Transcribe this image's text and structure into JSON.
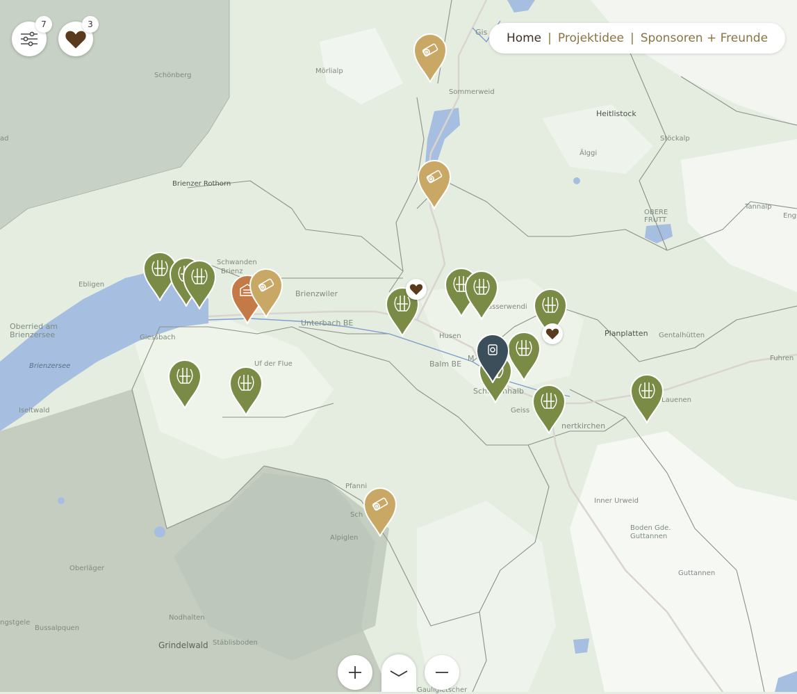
{
  "header": {
    "filter_count": "7",
    "favorites_count": "3"
  },
  "nav": {
    "items": [
      {
        "label": "Home"
      },
      {
        "label": "Projektidee"
      },
      {
        "label": "Sponsoren + Freunde"
      }
    ],
    "separator": "|"
  },
  "places": {
    "giswil": "Gis",
    "moerlialp": "Mörlialp",
    "sommerweid": "Sommerweid",
    "heitlistock": "Heitlistock",
    "stoeckalp": "Stöckalp",
    "aelggi": "Älggi",
    "schoenberg": "Schönberg",
    "brienzer_rothorn": "Brienzer Rothorn",
    "obere_frutt": "OBERE\nFRUTT",
    "tannalp": "Tannalp",
    "engstlen": "Engs",
    "schwanden": "Schwanden",
    "brienz": "Brienz",
    "brienzwiler": "Brienzwiler",
    "ebligen": "Ebligen",
    "unterbach": "Unterbach BE",
    "hasliberg": "asserwendi",
    "planplatten": "Planplatten",
    "gental": "Gentalhütten",
    "fuhren": "Fuhren",
    "oberried": "Oberried am\nBrienzersee",
    "giessbach": "Giessbach",
    "brienzersee": "Brienzersee",
    "iseltwald": "Iseltwald",
    "ufderflue": "Uf der Flue",
    "husen": "Husen",
    "balm": "Balm BE",
    "m": "M",
    "schattenhalb": "Schattenhalb",
    "geissholz": "Geiss",
    "innertkirchen": "nertkirchen",
    "wilerlauenen": "Lauenen",
    "pfanni": "Pfanni",
    "schwarzwald": "Sch",
    "alpiglen": "Alpiglen",
    "obrlaeger": "Oberläger",
    "nodhalten": "Nodhalten",
    "bussalp": "Bussalpquen",
    "staeblisboden": "Stäblisboden",
    "grindelwald": "Grindelwald",
    "innerurweid": "Inner Urweid",
    "bodenguttannen": "Boden Gde.\nGuttannen",
    "guttannen": "Guttannen",
    "gauligletscher": "Gauligletscher",
    "ad": "ad",
    "mb": "mb",
    "ngstgele": "ngstgele"
  },
  "pins": [
    {
      "type": "sawmill",
      "color": "#c9a765"
    },
    {
      "type": "sawmill",
      "color": "#c9a765"
    },
    {
      "type": "forest",
      "color": "#7a8b45"
    },
    {
      "type": "forest",
      "color": "#7a8b45"
    },
    {
      "type": "forest",
      "color": "#7a8b45"
    },
    {
      "type": "carpentry",
      "color": "#c47a47"
    },
    {
      "type": "sawmill",
      "color": "#c9a765"
    },
    {
      "type": "forest",
      "color": "#7a8b45"
    },
    {
      "type": "forest",
      "color": "#7a8b45"
    },
    {
      "type": "forest",
      "color": "#7a8b45"
    },
    {
      "type": "forest",
      "color": "#7a8b45"
    },
    {
      "type": "forest",
      "color": "#7a8b45"
    },
    {
      "type": "forest",
      "color": "#7a8b45"
    },
    {
      "type": "forest",
      "color": "#7a8b45"
    },
    {
      "type": "forest",
      "color": "#7a8b45"
    },
    {
      "type": "forest",
      "color": "#7a8b45"
    },
    {
      "type": "forest",
      "color": "#7a8b45"
    },
    {
      "type": "sawmill",
      "color": "#c9a765"
    },
    {
      "type": "special",
      "color": "#3b4f5a"
    }
  ],
  "colors": {
    "forest_pin": "#7a8b45",
    "sawmill_pin": "#c9a765",
    "carpentry_pin": "#c47a47",
    "heart": "#5a3a1c",
    "nav_text": "#8a7442",
    "nav_active": "#3d3124",
    "lake": "#a6bedf"
  },
  "icons": {
    "filter": "sliders-icon",
    "favorites": "heart-icon",
    "zoom_in": "plus-icon",
    "zoom_out": "minus-icon",
    "drawer": "chevron-down-icon"
  }
}
